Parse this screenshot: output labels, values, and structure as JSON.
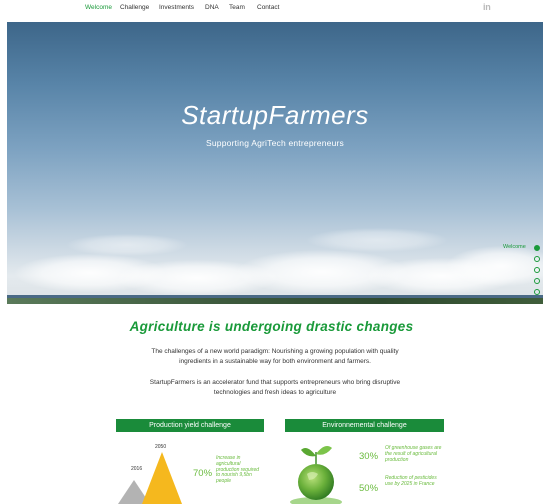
{
  "nav": {
    "items": [
      {
        "label": "Welcome",
        "active": true
      },
      {
        "label": "Challenge",
        "active": false
      },
      {
        "label": "Investments",
        "active": false
      },
      {
        "label": "DNA",
        "active": false
      },
      {
        "label": "Team",
        "active": false
      },
      {
        "label": "Contact",
        "active": false
      }
    ],
    "social": "in",
    "social_icon": "linkedin-icon"
  },
  "hero": {
    "title": "StartupFarmers",
    "subtitle": "Supporting AgriTech entrepreneurs"
  },
  "side_nav": {
    "active_label": "Welcome",
    "dot_count": 5
  },
  "main": {
    "heading": "Agriculture is undergoing drastic changes",
    "paragraphs": [
      "The challenges of a new world paradigm: Nourishing a growing population with quality ingredients in a sustainable way for both environment and farmers.",
      "StartupFarmers is an accelerator fund that supports entrepreneurs who bring disruptive technologies and fresh ideas to agriculture"
    ]
  },
  "boxes": [
    {
      "title": "Production yield challenge",
      "years": [
        "2050",
        "2016"
      ],
      "stats": [
        {
          "pct": "70%",
          "text": "Increase in agricultural production required to nourish 9,5bn people"
        }
      ]
    },
    {
      "title": "Environnemental challenge",
      "stats": [
        {
          "pct": "30%",
          "text": "Of greenhouse gases are the result of agricultural production"
        },
        {
          "pct": "50%",
          "text": "Reduction of pesticides use by 2025 in France"
        }
      ]
    }
  ],
  "colors": {
    "brand_green": "#1a9a3a",
    "header_green": "#1a8b3a",
    "light_green": "#6abb3e",
    "pyramid_gray": "#b3b3b3",
    "pyramid_yellow": "#f5b81e"
  }
}
